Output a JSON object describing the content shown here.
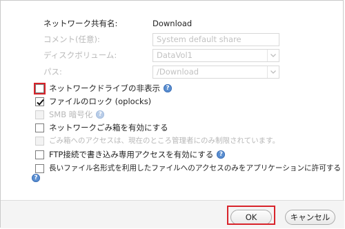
{
  "share": {
    "name_label": "ネットワーク共有名:",
    "name_value": "Download",
    "comment_label": "コメント(任意):",
    "comment_placeholder": "System default share",
    "volume_label": "ディスクボリューム:",
    "volume_value": "DataVol1",
    "path_label": "パス:",
    "path_value": "/Download"
  },
  "options": {
    "hide_drive": {
      "label": "ネットワークドライブの非表示",
      "checked": false
    },
    "oplocks": {
      "label": "ファイルのロック (oplocks)",
      "checked": true
    },
    "smb_encrypt": {
      "label": "SMB 暗号化",
      "checked": false,
      "disabled": true
    },
    "recycle_bin": {
      "label": "ネットワークごみ箱を有効にする",
      "checked": false
    },
    "recycle_admin_only": {
      "label": "ごみ箱へのアクセスは、現在のところ管理者にのみ制限されています。",
      "checked": false,
      "disabled": true
    },
    "ftp_write_only": {
      "label": "FTP接続で書き込み専用アクセスを有効にする",
      "checked": false
    },
    "long_filename": {
      "label": "長いファイル名形式を利用したファイルへのアクセスのみをアプリケーションに許可する",
      "checked": false
    }
  },
  "help_glyph": "?",
  "icons": [
    "help-icon",
    "checkmark-icon",
    "chevron-down-icon"
  ],
  "colors": {
    "highlight": "#d8232a",
    "help": "#5b8fd1"
  },
  "footer": {
    "ok_label": "OK",
    "cancel_label": "キャンセル"
  }
}
